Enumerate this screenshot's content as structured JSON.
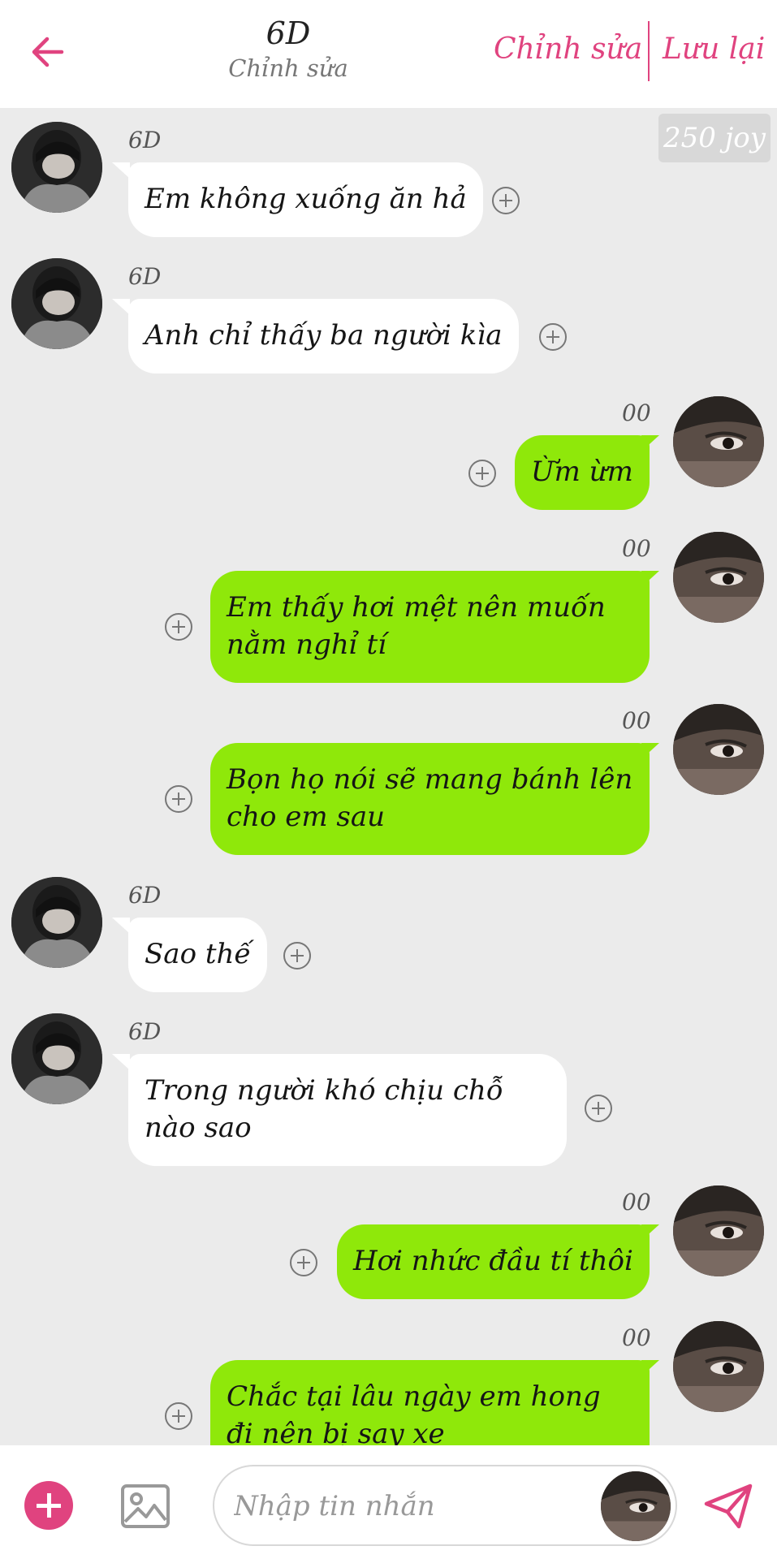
{
  "header": {
    "title": "6D",
    "subtitle": "Chỉnh sửa",
    "edit_label": "Chỉnh sửa",
    "save_label": "Lưu lại"
  },
  "joy_badge": "250 joy",
  "messages": [
    {
      "sender": "6D",
      "text": "Em không xuống ăn hả",
      "direction": "in"
    },
    {
      "sender": "6D",
      "text": "Anh chỉ thấy ba người kìa",
      "direction": "in"
    },
    {
      "sender": "00",
      "text": "Ừm ừm",
      "direction": "out"
    },
    {
      "sender": "00",
      "text": "Em thấy hơi mệt nên muốn nằm nghỉ tí",
      "direction": "out"
    },
    {
      "sender": "00",
      "text": "Bọn họ nói sẽ mang bánh lên cho em sau",
      "direction": "out"
    },
    {
      "sender": "6D",
      "text": "Sao thế",
      "direction": "in"
    },
    {
      "sender": "6D",
      "text": "Trong người khó chịu chỗ nào sao",
      "direction": "in"
    },
    {
      "sender": "00",
      "text": "Hơi nhức đầu tí thôi",
      "direction": "out"
    },
    {
      "sender": "00",
      "text": "Chắc tại lâu ngày em hong đi nên bị say xe",
      "direction": "out"
    }
  ],
  "composer": {
    "placeholder": "Nhập tin nhắn",
    "value": ""
  },
  "colors": {
    "accent": "#e0437f",
    "outgoing_bubble": "#8fe80a",
    "incoming_bubble": "#ffffff",
    "background": "#ebebeb"
  },
  "icons": {
    "back": "arrow-left-icon",
    "add": "plus-icon",
    "image": "image-icon",
    "send": "paper-plane-icon",
    "bubble_action": "plus-circle-icon"
  }
}
